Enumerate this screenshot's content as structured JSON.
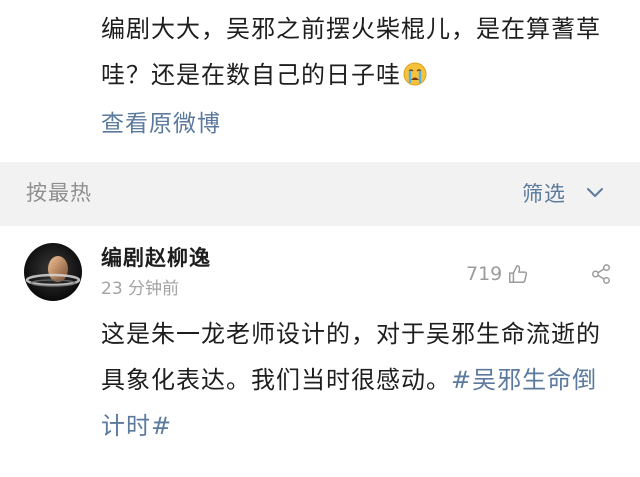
{
  "post": {
    "text": "编剧大大，吴邪之前摆火柴棍儿，是在算蓍草哇？还是在数自己的日子哇",
    "emoji": "crying-face-emoji",
    "view_original_label": "查看原微博"
  },
  "sort_bar": {
    "sort_label": "按最热",
    "filter_label": "筛选",
    "filter_icon": "chevron-down-icon"
  },
  "comment": {
    "username": "编剧赵柳逸",
    "timestamp": "23 分钟前",
    "like_count": "719",
    "like_icon": "thumbs-up-icon",
    "share_icon": "share-icon",
    "text": "这是朱一龙老师设计的，对于吴邪生命流逝的具象化表达。我们当时很感动。",
    "hashtag": "#吴邪生命倒计时#"
  },
  "colors": {
    "link": "#5b7a9d",
    "text": "#1e1e1e",
    "muted": "#a3a3a3",
    "bar_background": "#f2f2f2"
  }
}
